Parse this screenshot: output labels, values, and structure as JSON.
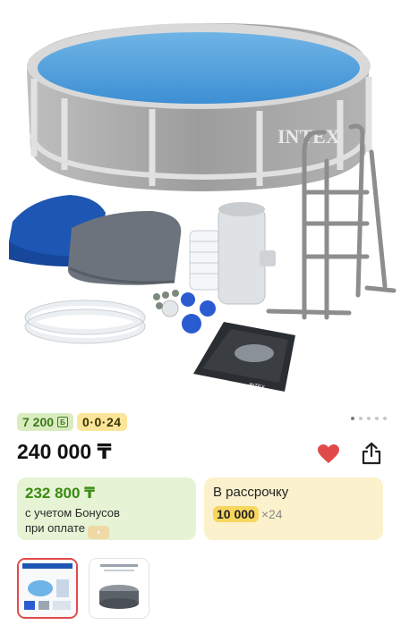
{
  "product": {
    "image_alt": "INTEX",
    "bonus_badge": "7 200",
    "bonus_badge_icon": "Б",
    "installment_badge": "0·0·24",
    "price": "240 000 ₸",
    "favorite_active": true
  },
  "gallery": {
    "total": 5,
    "active_index": 0
  },
  "bonus_card": {
    "price": "232 800 ₸",
    "line1": "с учетом Бонусов",
    "line2": "при оплате"
  },
  "installment_card": {
    "title": "В рассрочку",
    "amount": "10 000",
    "multiplier": "×24"
  },
  "colors": {
    "accent_red": "#e24a4a",
    "bonus_green": "#3a8a12",
    "installment_yellow": "#f7d65e"
  }
}
